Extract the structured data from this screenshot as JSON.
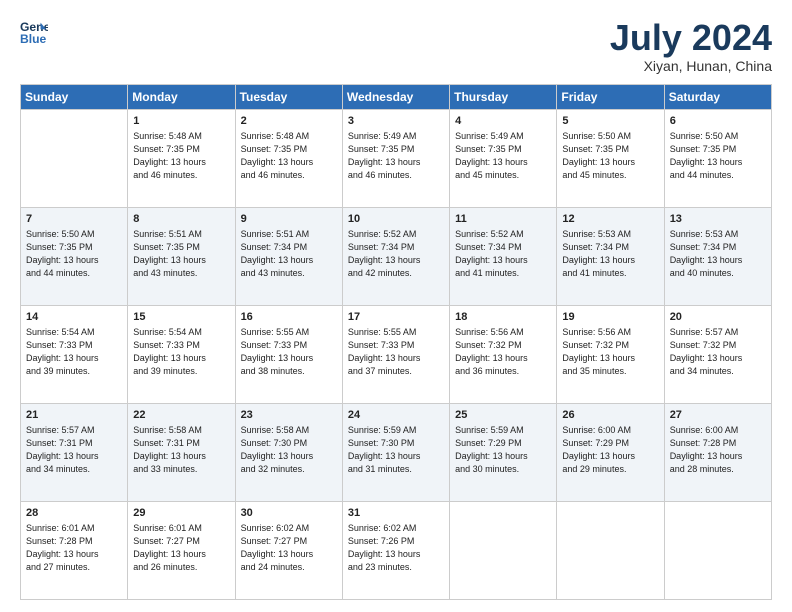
{
  "header": {
    "logo_line1": "General",
    "logo_line2": "Blue",
    "main_title": "July 2024",
    "subtitle": "Xiyan, Hunan, China"
  },
  "calendar": {
    "days_of_week": [
      "Sunday",
      "Monday",
      "Tuesday",
      "Wednesday",
      "Thursday",
      "Friday",
      "Saturday"
    ],
    "weeks": [
      [
        {
          "day": "",
          "content": ""
        },
        {
          "day": "1",
          "content": "Sunrise: 5:48 AM\nSunset: 7:35 PM\nDaylight: 13 hours\nand 46 minutes."
        },
        {
          "day": "2",
          "content": "Sunrise: 5:48 AM\nSunset: 7:35 PM\nDaylight: 13 hours\nand 46 minutes."
        },
        {
          "day": "3",
          "content": "Sunrise: 5:49 AM\nSunset: 7:35 PM\nDaylight: 13 hours\nand 46 minutes."
        },
        {
          "day": "4",
          "content": "Sunrise: 5:49 AM\nSunset: 7:35 PM\nDaylight: 13 hours\nand 45 minutes."
        },
        {
          "day": "5",
          "content": "Sunrise: 5:50 AM\nSunset: 7:35 PM\nDaylight: 13 hours\nand 45 minutes."
        },
        {
          "day": "6",
          "content": "Sunrise: 5:50 AM\nSunset: 7:35 PM\nDaylight: 13 hours\nand 44 minutes."
        }
      ],
      [
        {
          "day": "7",
          "content": "Sunrise: 5:50 AM\nSunset: 7:35 PM\nDaylight: 13 hours\nand 44 minutes."
        },
        {
          "day": "8",
          "content": "Sunrise: 5:51 AM\nSunset: 7:35 PM\nDaylight: 13 hours\nand 43 minutes."
        },
        {
          "day": "9",
          "content": "Sunrise: 5:51 AM\nSunset: 7:34 PM\nDaylight: 13 hours\nand 43 minutes."
        },
        {
          "day": "10",
          "content": "Sunrise: 5:52 AM\nSunset: 7:34 PM\nDaylight: 13 hours\nand 42 minutes."
        },
        {
          "day": "11",
          "content": "Sunrise: 5:52 AM\nSunset: 7:34 PM\nDaylight: 13 hours\nand 41 minutes."
        },
        {
          "day": "12",
          "content": "Sunrise: 5:53 AM\nSunset: 7:34 PM\nDaylight: 13 hours\nand 41 minutes."
        },
        {
          "day": "13",
          "content": "Sunrise: 5:53 AM\nSunset: 7:34 PM\nDaylight: 13 hours\nand 40 minutes."
        }
      ],
      [
        {
          "day": "14",
          "content": "Sunrise: 5:54 AM\nSunset: 7:33 PM\nDaylight: 13 hours\nand 39 minutes."
        },
        {
          "day": "15",
          "content": "Sunrise: 5:54 AM\nSunset: 7:33 PM\nDaylight: 13 hours\nand 39 minutes."
        },
        {
          "day": "16",
          "content": "Sunrise: 5:55 AM\nSunset: 7:33 PM\nDaylight: 13 hours\nand 38 minutes."
        },
        {
          "day": "17",
          "content": "Sunrise: 5:55 AM\nSunset: 7:33 PM\nDaylight: 13 hours\nand 37 minutes."
        },
        {
          "day": "18",
          "content": "Sunrise: 5:56 AM\nSunset: 7:32 PM\nDaylight: 13 hours\nand 36 minutes."
        },
        {
          "day": "19",
          "content": "Sunrise: 5:56 AM\nSunset: 7:32 PM\nDaylight: 13 hours\nand 35 minutes."
        },
        {
          "day": "20",
          "content": "Sunrise: 5:57 AM\nSunset: 7:32 PM\nDaylight: 13 hours\nand 34 minutes."
        }
      ],
      [
        {
          "day": "21",
          "content": "Sunrise: 5:57 AM\nSunset: 7:31 PM\nDaylight: 13 hours\nand 34 minutes."
        },
        {
          "day": "22",
          "content": "Sunrise: 5:58 AM\nSunset: 7:31 PM\nDaylight: 13 hours\nand 33 minutes."
        },
        {
          "day": "23",
          "content": "Sunrise: 5:58 AM\nSunset: 7:30 PM\nDaylight: 13 hours\nand 32 minutes."
        },
        {
          "day": "24",
          "content": "Sunrise: 5:59 AM\nSunset: 7:30 PM\nDaylight: 13 hours\nand 31 minutes."
        },
        {
          "day": "25",
          "content": "Sunrise: 5:59 AM\nSunset: 7:29 PM\nDaylight: 13 hours\nand 30 minutes."
        },
        {
          "day": "26",
          "content": "Sunrise: 6:00 AM\nSunset: 7:29 PM\nDaylight: 13 hours\nand 29 minutes."
        },
        {
          "day": "27",
          "content": "Sunrise: 6:00 AM\nSunset: 7:28 PM\nDaylight: 13 hours\nand 28 minutes."
        }
      ],
      [
        {
          "day": "28",
          "content": "Sunrise: 6:01 AM\nSunset: 7:28 PM\nDaylight: 13 hours\nand 27 minutes."
        },
        {
          "day": "29",
          "content": "Sunrise: 6:01 AM\nSunset: 7:27 PM\nDaylight: 13 hours\nand 26 minutes."
        },
        {
          "day": "30",
          "content": "Sunrise: 6:02 AM\nSunset: 7:27 PM\nDaylight: 13 hours\nand 24 minutes."
        },
        {
          "day": "31",
          "content": "Sunrise: 6:02 AM\nSunset: 7:26 PM\nDaylight: 13 hours\nand 23 minutes."
        },
        {
          "day": "",
          "content": ""
        },
        {
          "day": "",
          "content": ""
        },
        {
          "day": "",
          "content": ""
        }
      ]
    ]
  }
}
